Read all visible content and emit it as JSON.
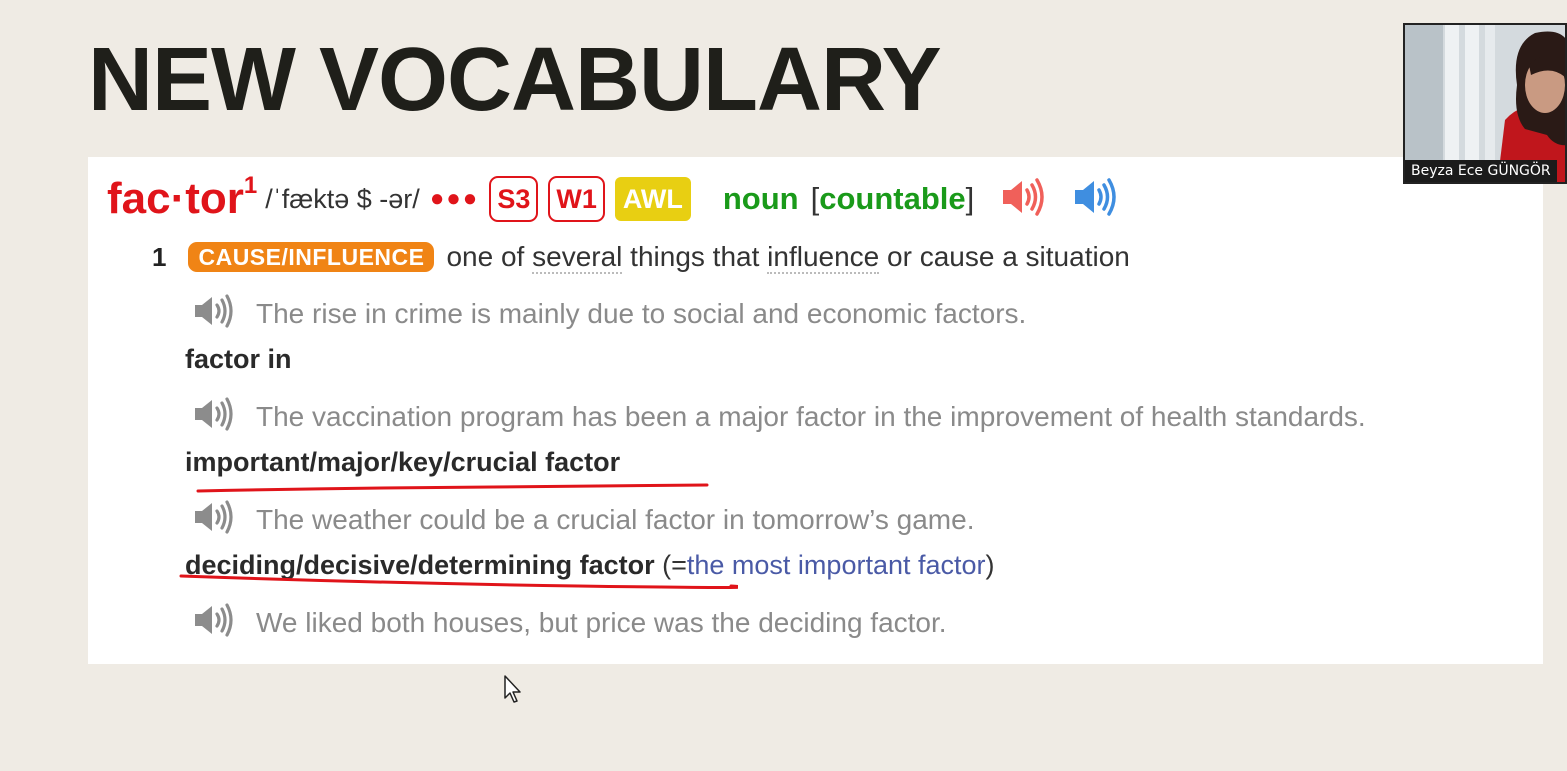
{
  "slide": {
    "title": "NEW VOCABULARY"
  },
  "entry": {
    "headword": "fac·tor",
    "homograph": "1",
    "pronunciation": "/ˈfæktə $ -ər/",
    "frequency_dots": "●●●",
    "badges": {
      "spoken": "S3",
      "written": "W1",
      "academic": "AWL"
    },
    "part_of_speech": "noun",
    "grammar_open": "[",
    "grammar": "countable",
    "grammar_close": "]",
    "audio_icons": [
      "british-pronunciation-speaker-icon",
      "american-pronunciation-speaker-icon"
    ],
    "colors": {
      "headword": "#e0141a",
      "signpost": "#f08415",
      "awl": "#e8cf12",
      "pos": "#1a9a1a",
      "annotation": "#e0141a"
    }
  },
  "sense": {
    "number": "1",
    "signpost": "CAUSE/INFLUENCE",
    "definition": {
      "part1": "one of ",
      "word1": "several",
      "part2": " things that ",
      "word2": "influence",
      "part3": " or cause a situation"
    }
  },
  "examples": [
    {
      "text": "The rise in crime is mainly due to social and economic factors."
    },
    {
      "text": "The vaccination program has been a major factor in the improvement of health standards."
    },
    {
      "text": "The weather could be a crucial factor in tomorrow’s game."
    },
    {
      "text": "We liked both houses, but price was the deciding factor."
    }
  ],
  "collocations": [
    {
      "text": "factor in"
    },
    {
      "text": "important/major/key/crucial factor"
    },
    {
      "text": "deciding/decisive/determining factor",
      "gloss_open": " (=",
      "gloss": "the most important factor",
      "gloss_close": ")"
    }
  ],
  "webcam": {
    "participant_name": "Beyza Ece GÜNGÖR"
  }
}
